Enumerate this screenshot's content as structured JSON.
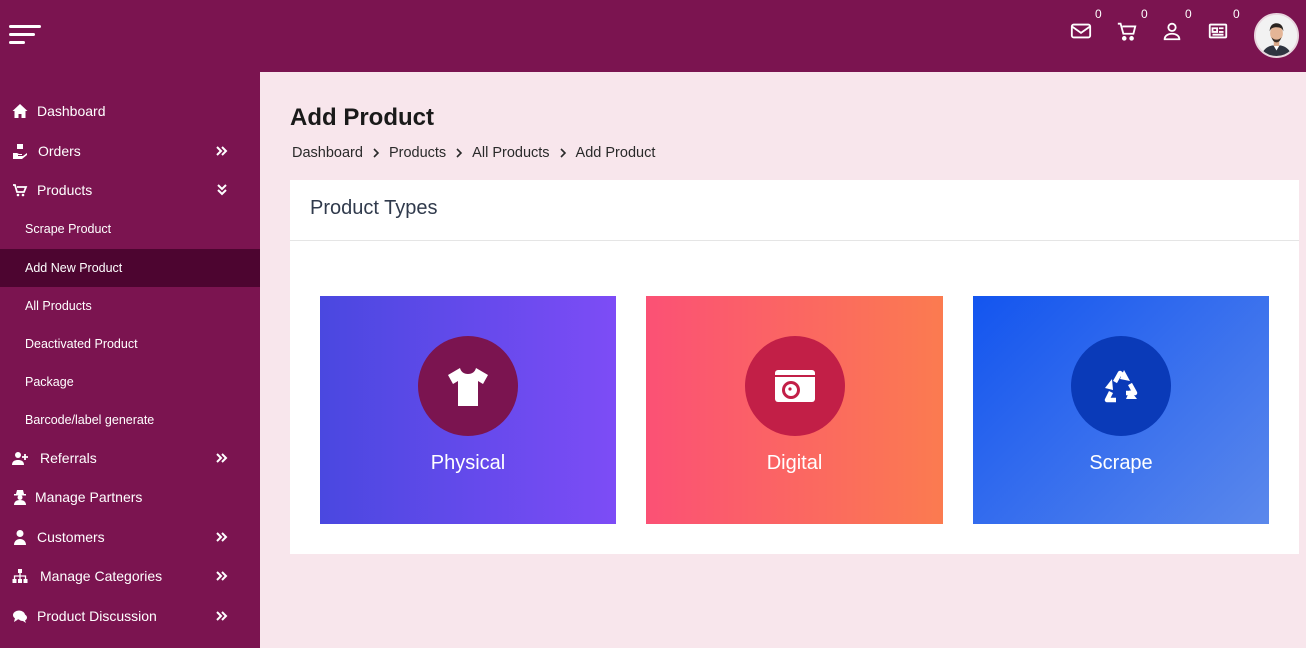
{
  "header": {
    "badges": {
      "messages": "0",
      "cart": "0",
      "users": "0",
      "news": "0"
    }
  },
  "sidebar": {
    "items": [
      {
        "label": "Dashboard"
      },
      {
        "label": "Orders"
      },
      {
        "label": "Products"
      },
      {
        "label": "Referrals"
      },
      {
        "label": "Manage Partners"
      },
      {
        "label": "Customers"
      },
      {
        "label": "Manage Categories"
      },
      {
        "label": "Product Discussion"
      }
    ],
    "products_submenu": [
      {
        "label": "Scrape Product"
      },
      {
        "label": "Add New Product",
        "active": true
      },
      {
        "label": "All Products"
      },
      {
        "label": "Deactivated Product"
      },
      {
        "label": "Package"
      },
      {
        "label": "Barcode/label generate"
      }
    ]
  },
  "main": {
    "title": "Add Product",
    "breadcrumb": [
      "Dashboard",
      "Products",
      "All Products",
      "Add Product"
    ],
    "card_title": "Product Types",
    "types": [
      {
        "label": "Physical",
        "icon": "tshirt-icon"
      },
      {
        "label": "Digital",
        "icon": "camera-icon"
      },
      {
        "label": "Scrape",
        "icon": "recycle-icon"
      }
    ]
  },
  "colors": {
    "brand": "#7b1450",
    "active_nav": "#4d0530",
    "page_bg": "#f8e6ec"
  }
}
